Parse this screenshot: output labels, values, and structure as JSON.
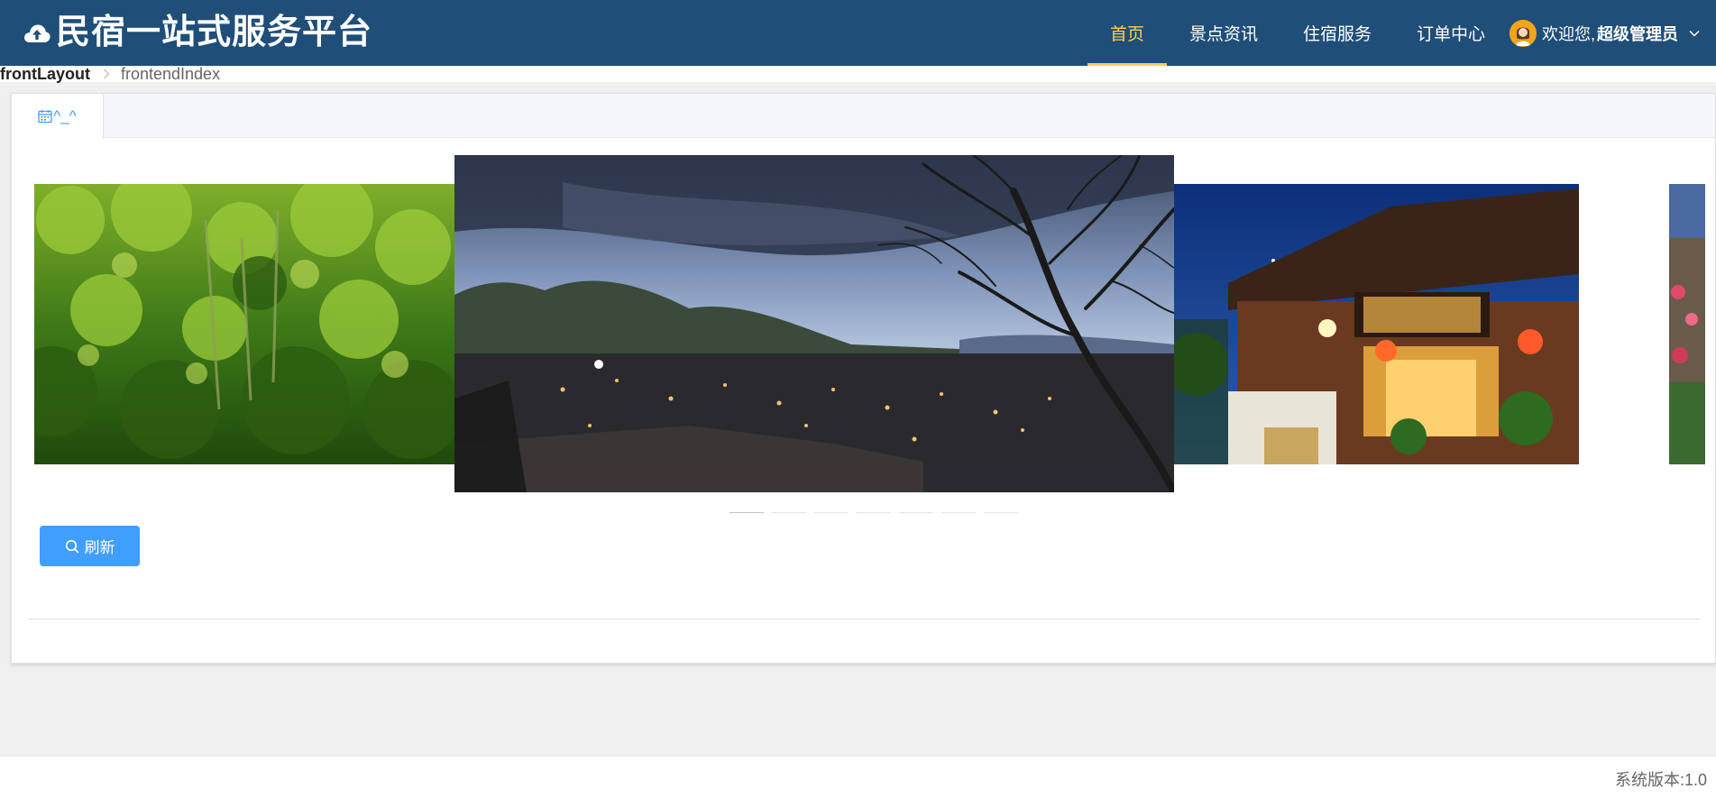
{
  "header": {
    "brand_icon": "cloud-upload-icon",
    "title": "民宿一站式服务平台",
    "background": "#1f4e79",
    "nav": [
      {
        "label": "首页",
        "active": true
      },
      {
        "label": "景点资讯",
        "active": false
      },
      {
        "label": "住宿服务",
        "active": false
      },
      {
        "label": "订单中心",
        "active": false
      }
    ],
    "active_color": "#ffd04b",
    "user": {
      "greeting": "欢迎您,",
      "name": "超级管理员",
      "avatar_icon": "user-avatar-icon",
      "caret_icon": "chevron-down-icon"
    }
  },
  "breadcrumb": {
    "items": [
      "frontLayout",
      "frontendIndex"
    ],
    "separator_icon": "chevron-right-icon"
  },
  "tabs": [
    {
      "label": "^_^",
      "icon": "calendar-icon",
      "active": true
    }
  ],
  "carousel": {
    "slides": [
      {
        "name": "rainforest-jungle",
        "position": "left"
      },
      {
        "name": "ancient-town-dusk-panorama",
        "position": "center"
      },
      {
        "name": "lit-traditional-inn",
        "position": "right"
      },
      {
        "name": "flower-building-edge",
        "position": "far-right"
      }
    ],
    "indicator_count": 7,
    "active_indicator": 0
  },
  "actions": {
    "refresh_label": "刷新",
    "refresh_icon": "search-icon",
    "button_color": "#409eff"
  },
  "footer": {
    "version": "系统版本:1.0"
  }
}
